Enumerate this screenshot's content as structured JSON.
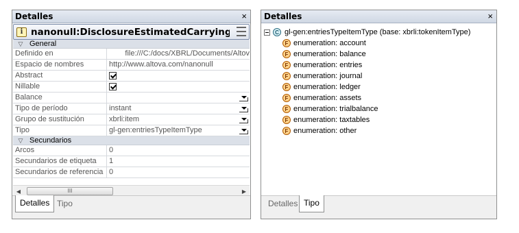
{
  "left_panel": {
    "title": "Detalles",
    "close_glyph": "×",
    "element_title": "nanonull:DisclosureEstimatedCarryingAndF...",
    "element_icon": "i",
    "sections": {
      "general": "General",
      "secondary": "Secundarios"
    },
    "rows": [
      {
        "key": "Definido en",
        "value": "file:///C:/docs/XBRL/Documents/Altov"
      },
      {
        "key": "Espacio de nombres",
        "value": "http://www.altova.com/nanonull"
      },
      {
        "key": "Abstract",
        "value": "checked"
      },
      {
        "key": "Nillable",
        "value": "checked"
      },
      {
        "key": "Balance",
        "value": ""
      },
      {
        "key": "Tipo de período",
        "value": "instant"
      },
      {
        "key": "Grupo de sustitución",
        "value": "xbrli:item"
      },
      {
        "key": "Tipo",
        "value": "gl-gen:entriesTypeItemType"
      }
    ],
    "secondary_rows": [
      {
        "key": "Arcos",
        "value": "0"
      },
      {
        "key": "Secundarios de etiqueta",
        "value": "1"
      },
      {
        "key": "Secundarios de referencia",
        "value": "0"
      }
    ],
    "scroll_thumb_glyph": "III",
    "tabs": [
      "Detalles",
      "Tipo"
    ],
    "active_tab": "Detalles"
  },
  "right_panel": {
    "title": "Detalles",
    "close_glyph": "×",
    "root_label": "gl-gen:entriesTypeItemType (base: xbrli:tokenItemType)",
    "root_icon": "C",
    "item_icon": "F",
    "items": [
      "enumeration: account",
      "enumeration: balance",
      "enumeration: entries",
      "enumeration: journal",
      "enumeration: ledger",
      "enumeration: assets",
      "enumeration: trialbalance",
      "enumeration: taxtables",
      "enumeration: other"
    ],
    "tabs": [
      "Detalles",
      "Tipo"
    ],
    "active_tab": "Tipo"
  }
}
